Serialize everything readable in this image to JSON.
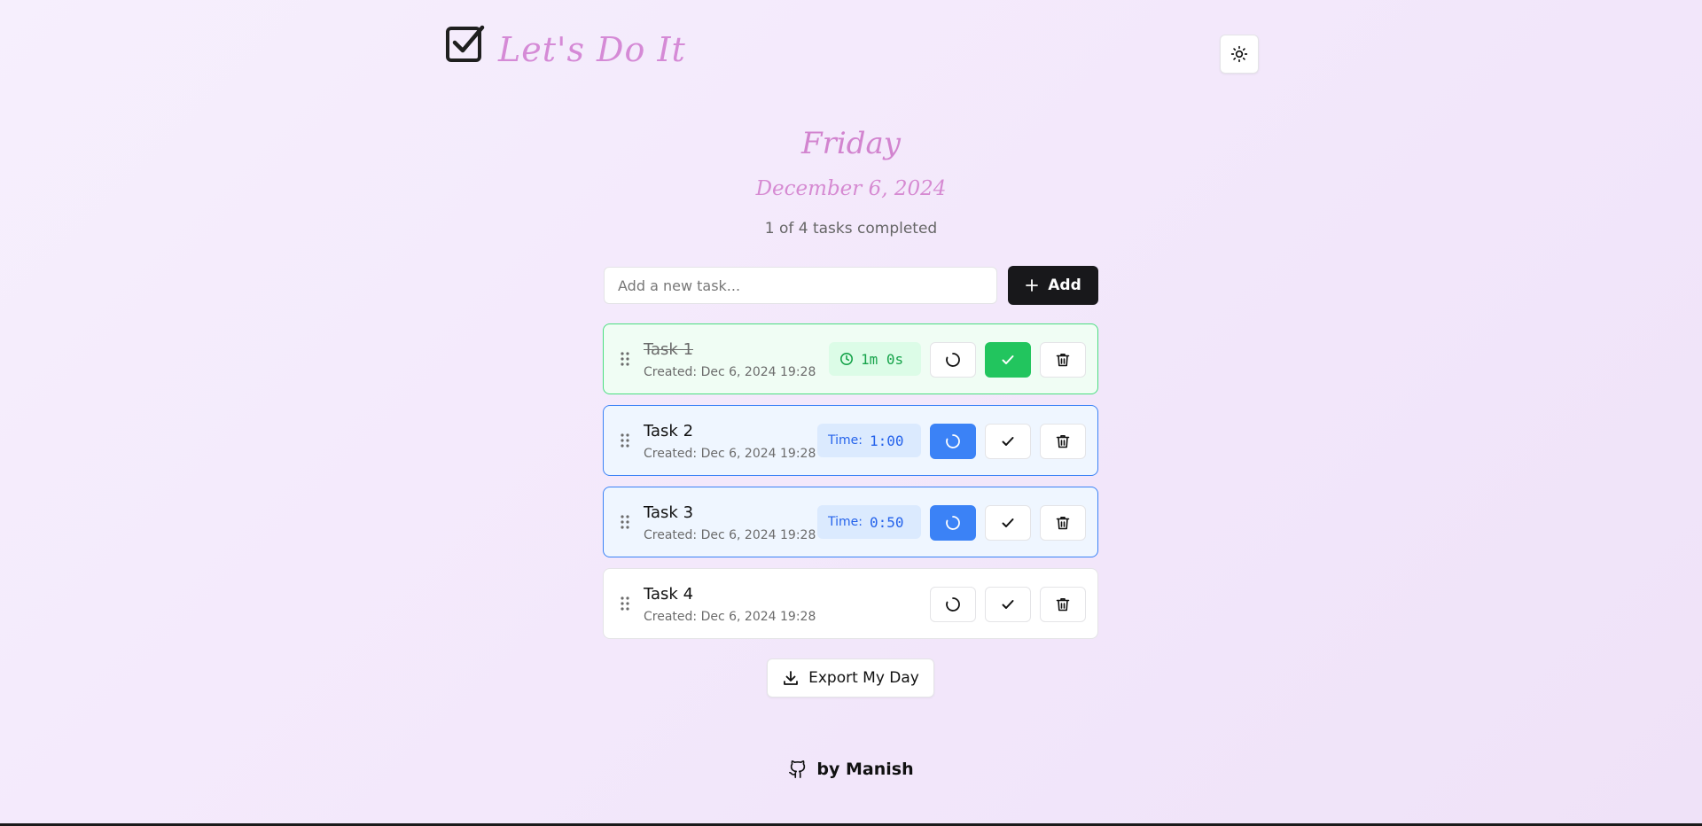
{
  "header": {
    "app_title": "Let's Do It",
    "logo_icon": "checkbox-icon",
    "theme_toggle_icon": "sun-icon"
  },
  "date": {
    "day": "Friday",
    "full_date": "December 6, 2024",
    "progress": "1 of 4 tasks completed"
  },
  "add_task": {
    "placeholder": "Add a new task...",
    "value": "",
    "button_label": "Add"
  },
  "tasks": [
    {
      "title": "Task 1",
      "created": "Created: Dec 6, 2024 19:28",
      "state": "completed",
      "timer_value": "1m 0s"
    },
    {
      "title": "Task 2",
      "created": "Created: Dec 6, 2024 19:28",
      "state": "running",
      "timer_label": "Time:",
      "timer_value": "1:00"
    },
    {
      "title": "Task 3",
      "created": "Created: Dec 6, 2024 19:28",
      "state": "running",
      "timer_label": "Time:",
      "timer_value": "0:50"
    },
    {
      "title": "Task 4",
      "created": "Created: Dec 6, 2024 19:28",
      "state": "idle"
    }
  ],
  "export_label": "Export My Day",
  "footer": {
    "text": "by Manish",
    "icon": "github-icon"
  },
  "colors": {
    "brand": "#d58ad6",
    "done_border": "#4ade80",
    "done_bg": "#f0fdf4",
    "active_border": "#3b82f6",
    "active_bg": "#eff6ff",
    "success": "#22c55e",
    "primary": "#3b82f6",
    "dark_button": "#18181b"
  }
}
